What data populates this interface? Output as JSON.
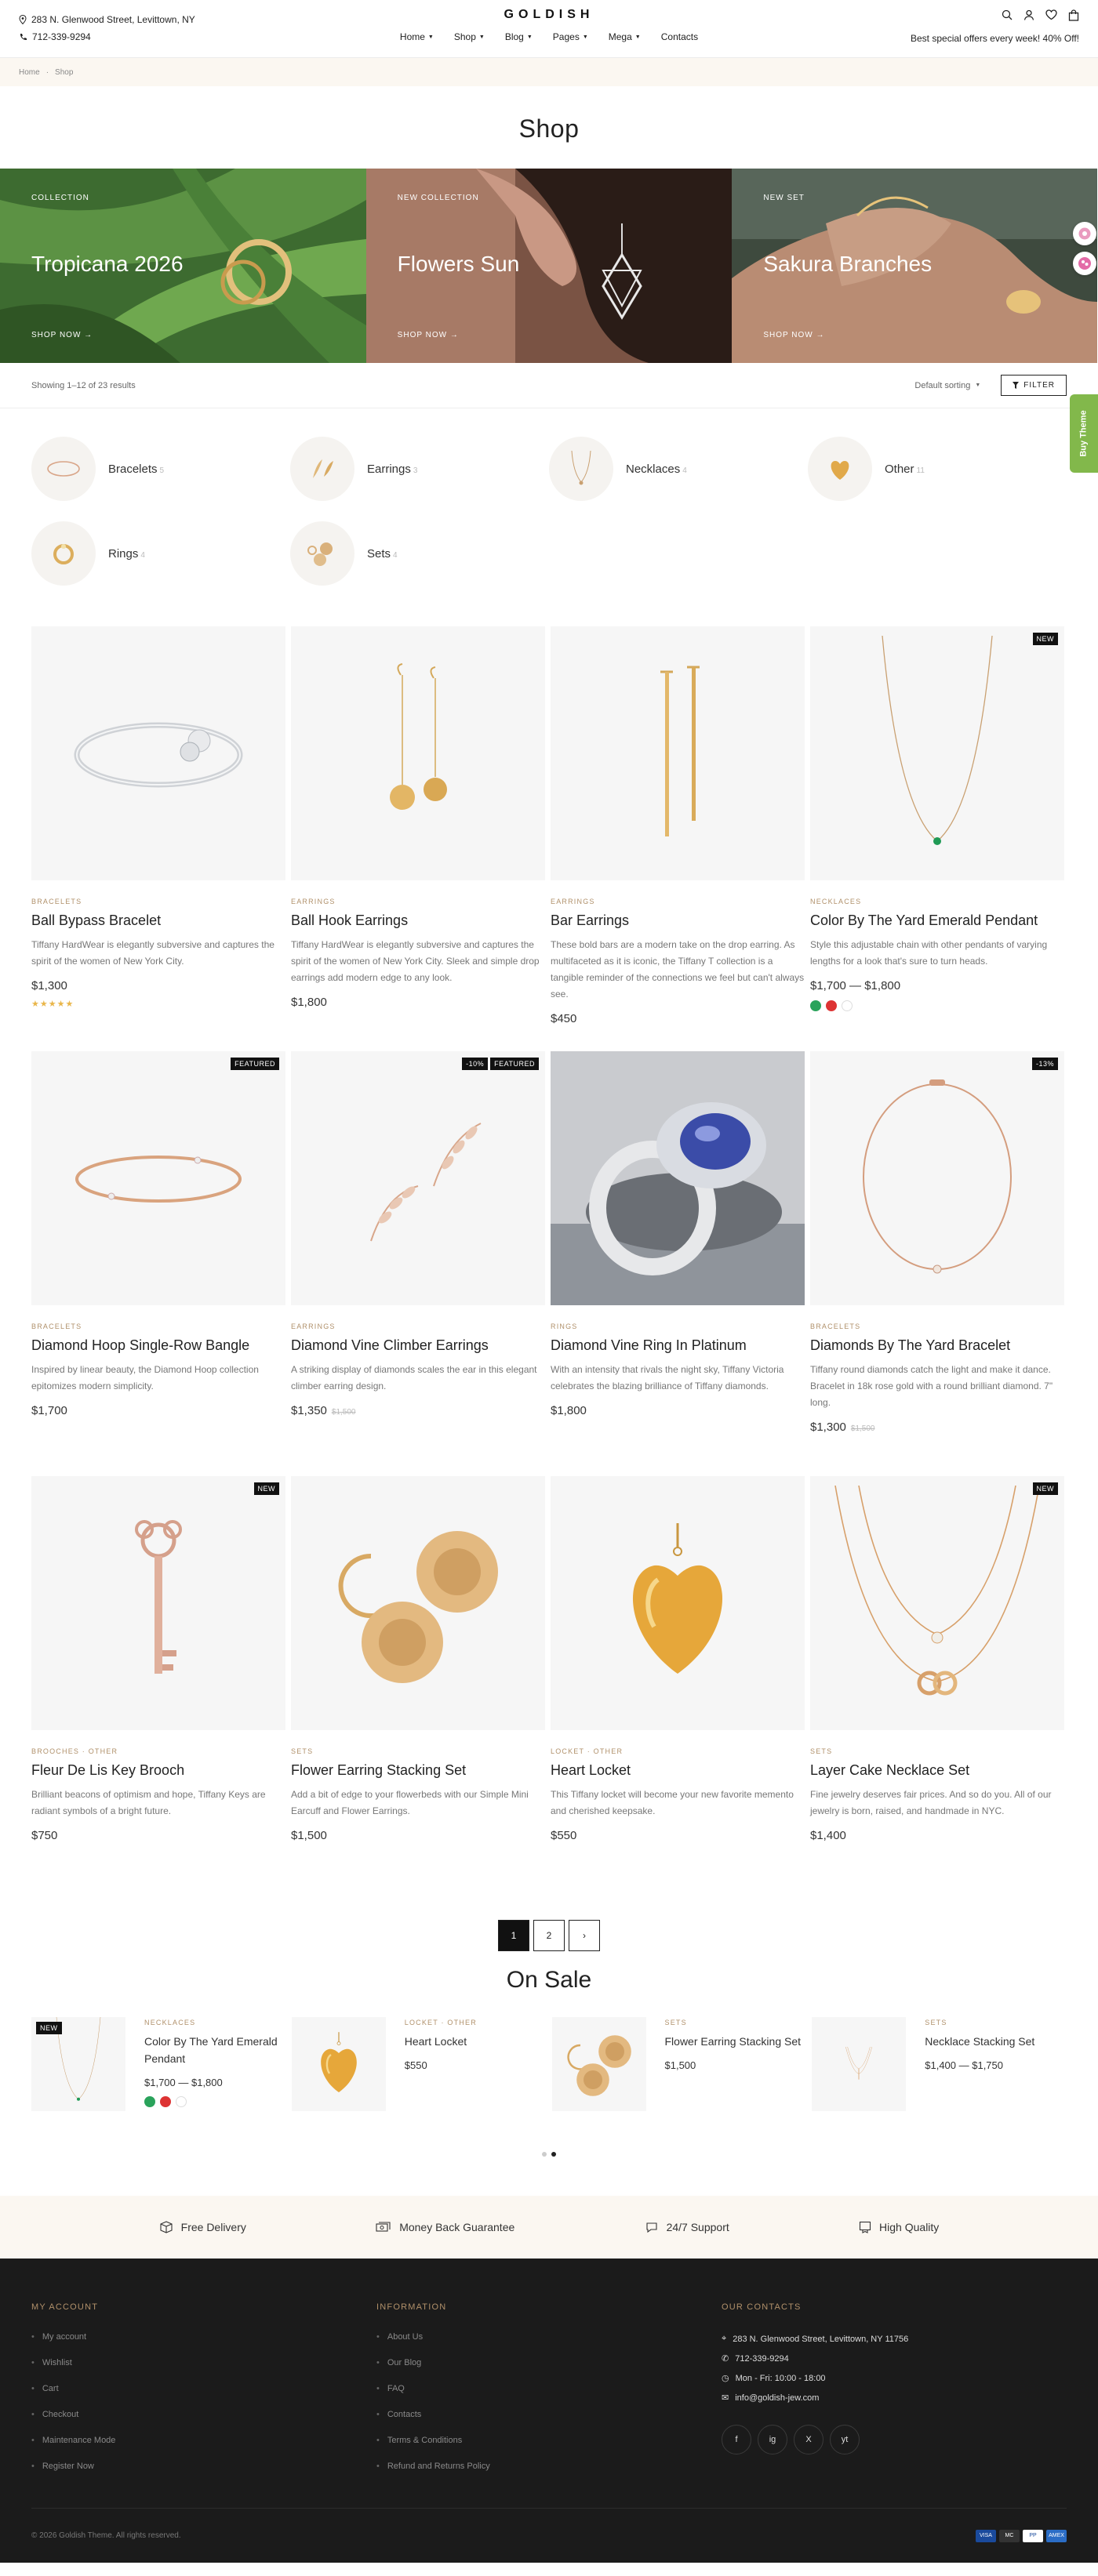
{
  "header": {
    "address": "283 N. Glenwood Street, Levittown, NY",
    "phone": "712-339-9294",
    "logo": "GOLDISH",
    "nav": [
      {
        "label": "Home",
        "dropdown": true
      },
      {
        "label": "Shop",
        "dropdown": true
      },
      {
        "label": "Blog",
        "dropdown": true
      },
      {
        "label": "Pages",
        "dropdown": true
      },
      {
        "label": "Mega",
        "dropdown": true
      },
      {
        "label": "Contacts",
        "dropdown": false
      }
    ],
    "promo": "Best special offers every week! 40% Off!",
    "icons": [
      "search-icon",
      "user-icon",
      "heart-icon",
      "bag-icon"
    ]
  },
  "breadcrumb": {
    "home": "Home",
    "current": "Shop"
  },
  "page_title": "Shop",
  "banners": [
    {
      "caption": "COLLECTION",
      "title": "Tropicana 2026",
      "cta": "SHOP NOW"
    },
    {
      "caption": "NEW COLLECTION",
      "title": "Flowers Sun",
      "cta": "SHOP NOW"
    },
    {
      "caption": "NEW SET",
      "title": "Sakura Branches",
      "cta": "SHOP NOW"
    }
  ],
  "side": {
    "buy_theme": "Buy Theme"
  },
  "toolbar": {
    "results": "Showing 1–12 of 23 results",
    "sort": "Default sorting",
    "filter": "FILTER"
  },
  "categories": [
    {
      "name": "Bracelets",
      "count": "5"
    },
    {
      "name": "Earrings",
      "count": "3"
    },
    {
      "name": "Necklaces",
      "count": "4"
    },
    {
      "name": "Other",
      "count": "11"
    },
    {
      "name": "Rings",
      "count": "4"
    },
    {
      "name": "Sets",
      "count": "4"
    }
  ],
  "products": [
    {
      "category": "BRACELETS",
      "name": "Ball Bypass Bracelet",
      "desc": "Tiffany HardWear is elegantly subversive and captures the spirit of the women of New York City.",
      "price": "$1,300",
      "old": "",
      "stars": "★★★★★",
      "badges": [],
      "art": "bangle-silver"
    },
    {
      "category": "EARRINGS",
      "name": "Ball Hook Earrings",
      "desc": "Tiffany HardWear is elegantly subversive and captures the spirit of the women of New York City. Sleek and simple drop earrings add modern edge to any look.",
      "price": "$1,800",
      "old": "",
      "stars": "",
      "badges": [],
      "art": "ball-earrings"
    },
    {
      "category": "EARRINGS",
      "name": "Bar Earrings",
      "desc": "These bold bars are a modern take on the drop earring. As multifaceted as it is iconic, the Tiffany T collection is a tangible reminder of the connections we feel but can't always see.",
      "price": "$450",
      "old": "",
      "stars": "",
      "badges": [],
      "art": "bar-earrings"
    },
    {
      "category": "NECKLACES",
      "name": "Color By The Yard Emerald Pendant",
      "desc": "Style this adjustable chain with other pendants of varying lengths for a look that's sure to turn heads.",
      "price": "$1,700  —  $1,800",
      "old": "",
      "stars": "",
      "badges": [
        "NEW"
      ],
      "art": "emerald-necklace",
      "swatches": [
        "#2aa35b",
        "#d33",
        "#fff"
      ]
    },
    {
      "category": "BRACELETS",
      "name": "Diamond Hoop Single-Row Bangle",
      "desc": "Inspired by linear beauty, the Diamond Hoop collection epitomizes modern simplicity.",
      "price": "$1,700",
      "old": "",
      "stars": "",
      "badges": [
        "FEATURED"
      ],
      "art": "gold-bangle"
    },
    {
      "category": "EARRINGS",
      "name": "Diamond Vine Climber Earrings",
      "desc": "A striking display of diamonds scales the ear in this elegant climber earring design.",
      "price": "$1,350",
      "old": "$1,500",
      "stars": "",
      "badges": [
        "-10%",
        "FEATURED"
      ],
      "art": "vine-earrings"
    },
    {
      "category": "RINGS",
      "name": "Diamond Vine Ring In Platinum",
      "desc": "With an intensity that rivals the night sky, Tiffany Victoria celebrates the blazing brilliance of Tiffany diamonds.",
      "price": "$1,800",
      "old": "",
      "stars": "",
      "badges": [],
      "art": "sapphire-ring"
    },
    {
      "category": "BRACELETS",
      "name": "Diamonds By The Yard Bracelet",
      "desc": "Tiffany round diamonds catch the light and make it dance. Bracelet in 18k rose gold with a round brilliant diamond. 7\" long.",
      "price": "$1,300",
      "old": "$1,500",
      "stars": "",
      "badges": [
        "-13%"
      ],
      "art": "chain-bracelet"
    },
    {
      "category": "BROOCHES  ·  OTHER",
      "name": "Fleur De Lis Key Brooch",
      "desc": "Brilliant beacons of optimism and hope, Tiffany Keys are radiant symbols of a bright future.",
      "price": "$750",
      "old": "",
      "stars": "",
      "badges": [
        "NEW"
      ],
      "art": "key"
    },
    {
      "category": "SETS",
      "name": "Flower Earring Stacking Set",
      "desc": "Add a bit of edge to your flowerbeds with our Simple Mini Earcuff and Flower Earrings.",
      "price": "$1,500",
      "old": "",
      "stars": "",
      "badges": [],
      "art": "flower-set"
    },
    {
      "category": "LOCKET  ·  OTHER",
      "name": "Heart Locket",
      "desc": "This Tiffany locket will become your new favorite memento and cherished keepsake.",
      "price": "$550",
      "old": "",
      "stars": "",
      "badges": [],
      "art": "heart"
    },
    {
      "category": "SETS",
      "name": "Layer Cake Necklace Set",
      "desc": "Fine jewelry deserves fair prices. And so do you. All of our jewelry is born, raised, and handmade in NYC.",
      "price": "$1,400",
      "old": "",
      "stars": "",
      "badges": [
        "NEW"
      ],
      "art": "layer-necklace"
    }
  ],
  "pagination": {
    "pages": [
      "1",
      "2"
    ],
    "next": "›",
    "current": "1"
  },
  "on_sale": {
    "title": "On Sale",
    "items": [
      {
        "category": "NECKLACES",
        "name": "Color By The Yard Emerald Pendant",
        "price": "$1,700  —  $1,800",
        "badge": "NEW",
        "art": "emerald-necklace",
        "swatches": [
          "#2aa35b",
          "#d33",
          "#fff"
        ]
      },
      {
        "category": "LOCKET  ·  OTHER",
        "name": "Heart Locket",
        "price": "$550",
        "badge": "",
        "art": "heart"
      },
      {
        "category": "SETS",
        "name": "Flower Earring Stacking Set",
        "price": "$1,500",
        "badge": "",
        "art": "flower-set"
      },
      {
        "category": "SETS",
        "name": "Necklace Stacking Set",
        "price": "$1,400  —  $1,750",
        "badge": "",
        "art": "stack-necklace"
      }
    ]
  },
  "features": [
    {
      "label": "Free Delivery",
      "icon": "box-icon"
    },
    {
      "label": "Money Back Guarantee",
      "icon": "money-icon"
    },
    {
      "label": "24/7 Support",
      "icon": "support-icon"
    },
    {
      "label": "High Quality",
      "icon": "quality-icon"
    }
  ],
  "footer": {
    "account": {
      "title": "MY ACCOUNT",
      "links": [
        "My account",
        "Wishlist",
        "Cart",
        "Checkout",
        "Maintenance Mode",
        "Register Now"
      ]
    },
    "info": {
      "title": "INFORMATION",
      "links": [
        "About Us",
        "Our Blog",
        "FAQ",
        "Contacts",
        "Terms & Conditions",
        "Refund and Returns Policy"
      ]
    },
    "contacts": {
      "title": "OUR CONTACTS",
      "address": "283 N. Glenwood Street, Levittown, NY 11756",
      "phone": "712-339-9294",
      "hours": "Mon - Fri: 10:00 - 18:00",
      "email": "info@goldish-jew.com"
    },
    "socials": [
      "f",
      "ig",
      "X",
      "yt"
    ],
    "copyright": "© 2026 Goldish Theme. All rights reserved.",
    "payments": [
      "VISA",
      "MC",
      "PP",
      "AMEX"
    ]
  },
  "colors": {
    "accent": "#b0906a",
    "footer_bg": "#1b1b1b",
    "cream": "#fbf7f1",
    "buy_theme": "#82b84b"
  }
}
